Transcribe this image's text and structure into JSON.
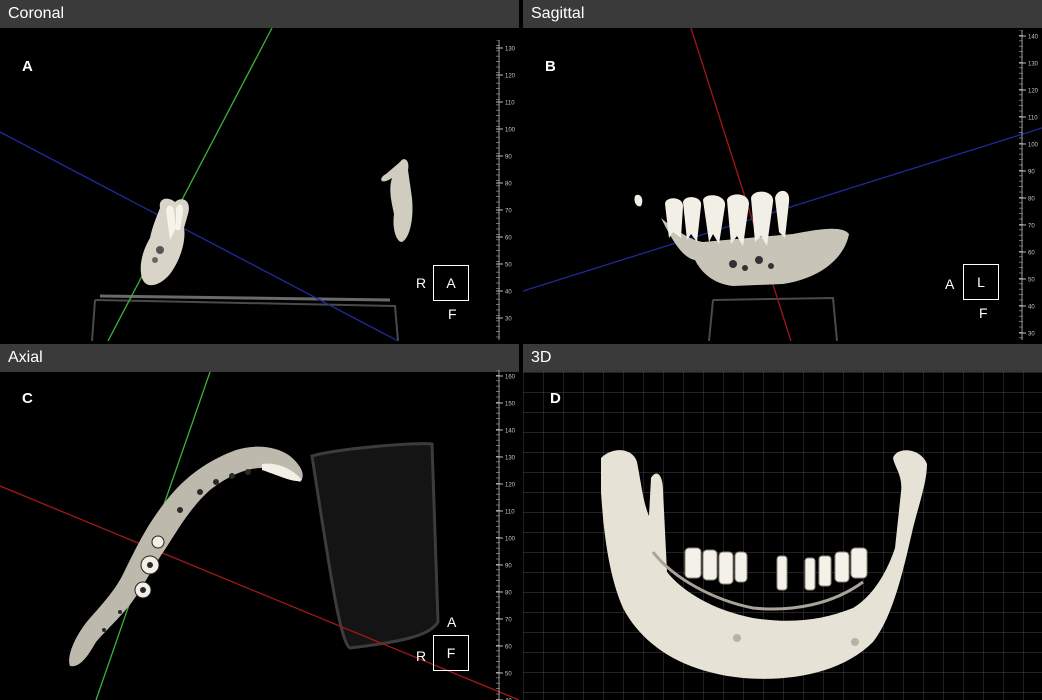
{
  "panes": {
    "coronal": {
      "title": "Coronal",
      "letter": "A",
      "orient_left": "R",
      "orient_box": "A",
      "orient_bottom": "F",
      "ruler_labels": [
        "130",
        "120",
        "110",
        "100",
        "90",
        "80",
        "70",
        "60",
        "50",
        "40",
        "30"
      ]
    },
    "sagittal": {
      "title": "Sagittal",
      "letter": "B",
      "orient_left": "A",
      "orient_box": "L",
      "orient_bottom": "F",
      "ruler_labels": [
        "140",
        "130",
        "120",
        "110",
        "100",
        "90",
        "80",
        "70",
        "60",
        "50",
        "40",
        "30"
      ]
    },
    "axial": {
      "title": "Axial",
      "letter": "C",
      "orient_top": "A",
      "orient_left": "R",
      "orient_box": "F",
      "ruler_labels": [
        "160",
        "150",
        "140",
        "130",
        "120",
        "110",
        "100",
        "90",
        "80",
        "70",
        "60",
        "50",
        "40"
      ]
    },
    "threed": {
      "title": "3D",
      "letter": "D"
    }
  },
  "colors": {
    "header_bg": "#3a3a3a",
    "crosshair_green": "#3bb33b",
    "crosshair_blue": "#1e2a9c",
    "crosshair_red": "#a01818",
    "bone": "#e8e4d8",
    "grid": "#5a5a5a"
  }
}
